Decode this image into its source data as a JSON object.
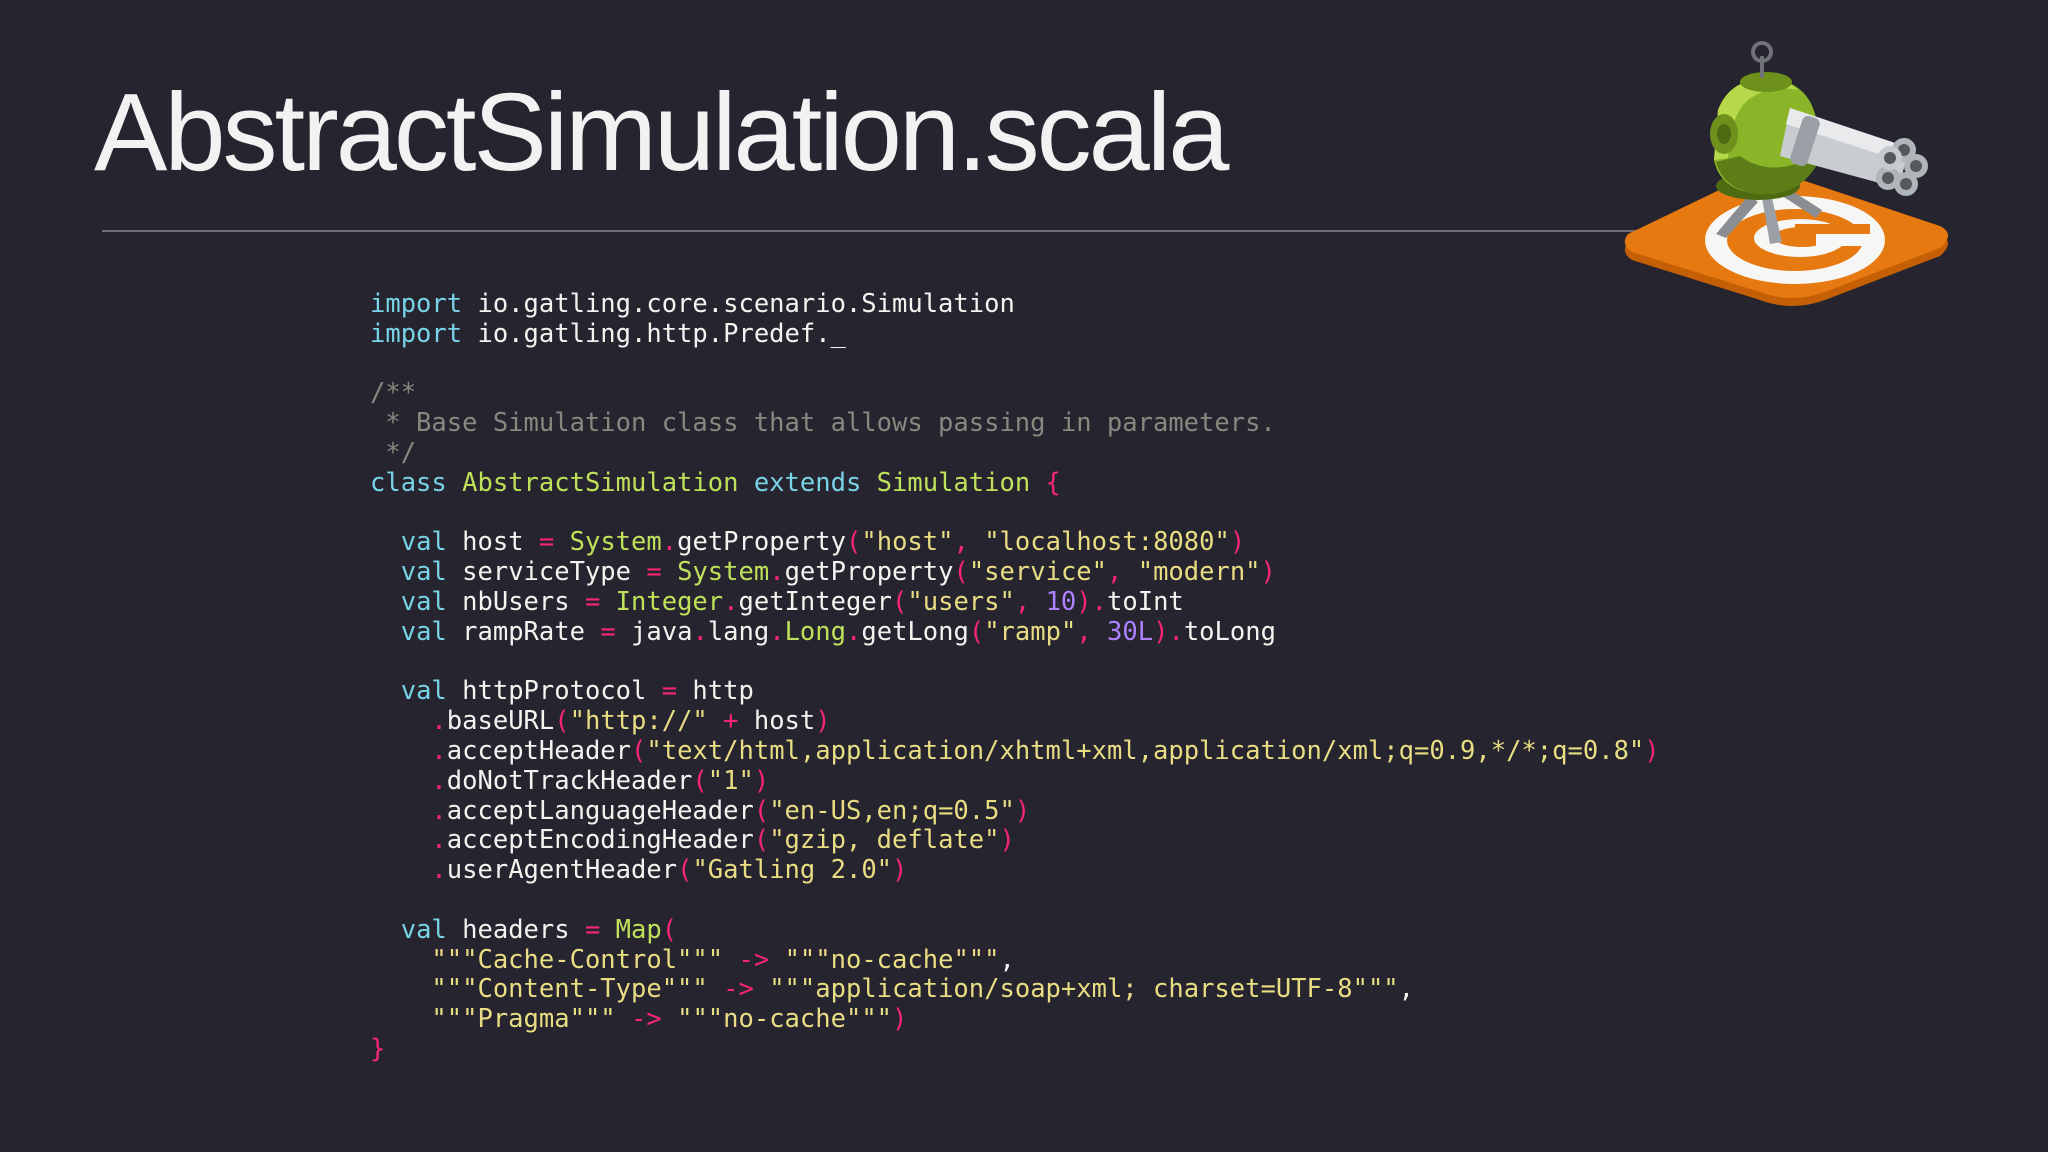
{
  "slide": {
    "title": "AbstractSimulation.scala"
  },
  "logo": {
    "icon": "gatling-cannon-logo"
  },
  "colors": {
    "background": "#25242f",
    "keyword": "#78d3e6",
    "type": "#bfe15a",
    "string": "#e9dd83",
    "number": "#ae81ff",
    "punctuation": "#f92672",
    "comment": "#88887f",
    "text": "#f3f3ef"
  },
  "code": {
    "language": "scala",
    "lines": [
      [
        [
          "kw",
          "import"
        ],
        [
          "tx",
          " io.gatling.core.scenario.Simulation"
        ]
      ],
      [
        [
          "kw",
          "import"
        ],
        [
          "tx",
          " io.gatling.http.Predef._"
        ]
      ],
      [],
      [
        [
          "cm",
          "/**"
        ]
      ],
      [
        [
          "cm",
          " * Base Simulation class that allows passing in parameters."
        ]
      ],
      [
        [
          "cm",
          " */"
        ]
      ],
      [
        [
          "kw",
          "class "
        ],
        [
          "ty",
          "AbstractSimulation "
        ],
        [
          "kw",
          "extends "
        ],
        [
          "ty",
          "Simulation "
        ],
        [
          "pu",
          "{"
        ]
      ],
      [],
      [
        [
          "tx",
          "  "
        ],
        [
          "kw",
          "val"
        ],
        [
          "tx",
          " host "
        ],
        [
          "pu",
          "="
        ],
        [
          "tx",
          " "
        ],
        [
          "ty",
          "System"
        ],
        [
          "pu",
          "."
        ],
        [
          "tx",
          "getProperty"
        ],
        [
          "pu",
          "("
        ],
        [
          "st",
          "\"host\""
        ],
        [
          "pu",
          ","
        ],
        [
          "tx",
          " "
        ],
        [
          "st",
          "\"localhost:8080\""
        ],
        [
          "pu",
          ")"
        ]
      ],
      [
        [
          "tx",
          "  "
        ],
        [
          "kw",
          "val"
        ],
        [
          "tx",
          " serviceType "
        ],
        [
          "pu",
          "="
        ],
        [
          "tx",
          " "
        ],
        [
          "ty",
          "System"
        ],
        [
          "pu",
          "."
        ],
        [
          "tx",
          "getProperty"
        ],
        [
          "pu",
          "("
        ],
        [
          "st",
          "\"service\""
        ],
        [
          "pu",
          ","
        ],
        [
          "tx",
          " "
        ],
        [
          "st",
          "\"modern\""
        ],
        [
          "pu",
          ")"
        ]
      ],
      [
        [
          "tx",
          "  "
        ],
        [
          "kw",
          "val"
        ],
        [
          "tx",
          " nbUsers "
        ],
        [
          "pu",
          "="
        ],
        [
          "tx",
          " "
        ],
        [
          "ty",
          "Integer"
        ],
        [
          "pu",
          "."
        ],
        [
          "tx",
          "getInteger"
        ],
        [
          "pu",
          "("
        ],
        [
          "st",
          "\"users\""
        ],
        [
          "pu",
          ","
        ],
        [
          "tx",
          " "
        ],
        [
          "nm",
          "10"
        ],
        [
          "pu",
          ")."
        ],
        [
          "tx",
          "toInt"
        ]
      ],
      [
        [
          "tx",
          "  "
        ],
        [
          "kw",
          "val"
        ],
        [
          "tx",
          " rampRate "
        ],
        [
          "pu",
          "="
        ],
        [
          "tx",
          " java"
        ],
        [
          "pu",
          "."
        ],
        [
          "tx",
          "lang"
        ],
        [
          "pu",
          "."
        ],
        [
          "ty",
          "Long"
        ],
        [
          "pu",
          "."
        ],
        [
          "tx",
          "getLong"
        ],
        [
          "pu",
          "("
        ],
        [
          "st",
          "\"ramp\""
        ],
        [
          "pu",
          ","
        ],
        [
          "tx",
          " "
        ],
        [
          "nm",
          "30L"
        ],
        [
          "pu",
          ")."
        ],
        [
          "tx",
          "toLong"
        ]
      ],
      [],
      [
        [
          "tx",
          "  "
        ],
        [
          "kw",
          "val"
        ],
        [
          "tx",
          " httpProtocol "
        ],
        [
          "pu",
          "="
        ],
        [
          "tx",
          " http"
        ]
      ],
      [
        [
          "tx",
          "    "
        ],
        [
          "pu",
          "."
        ],
        [
          "tx",
          "baseURL"
        ],
        [
          "pu",
          "("
        ],
        [
          "st",
          "\"http://\""
        ],
        [
          "tx",
          " "
        ],
        [
          "pu",
          "+"
        ],
        [
          "tx",
          " host"
        ],
        [
          "pu",
          ")"
        ]
      ],
      [
        [
          "tx",
          "    "
        ],
        [
          "pu",
          "."
        ],
        [
          "tx",
          "acceptHeader"
        ],
        [
          "pu",
          "("
        ],
        [
          "st",
          "\"text/html,application/xhtml+xml,application/xml;q=0.9,*/*;q=0.8\""
        ],
        [
          "pu",
          ")"
        ]
      ],
      [
        [
          "tx",
          "    "
        ],
        [
          "pu",
          "."
        ],
        [
          "tx",
          "doNotTrackHeader"
        ],
        [
          "pu",
          "("
        ],
        [
          "st",
          "\"1\""
        ],
        [
          "pu",
          ")"
        ]
      ],
      [
        [
          "tx",
          "    "
        ],
        [
          "pu",
          "."
        ],
        [
          "tx",
          "acceptLanguageHeader"
        ],
        [
          "pu",
          "("
        ],
        [
          "st",
          "\"en-US,en;q=0.5\""
        ],
        [
          "pu",
          ")"
        ]
      ],
      [
        [
          "tx",
          "    "
        ],
        [
          "pu",
          "."
        ],
        [
          "tx",
          "acceptEncodingHeader"
        ],
        [
          "pu",
          "("
        ],
        [
          "st",
          "\"gzip, deflate\""
        ],
        [
          "pu",
          ")"
        ]
      ],
      [
        [
          "tx",
          "    "
        ],
        [
          "pu",
          "."
        ],
        [
          "tx",
          "userAgentHeader"
        ],
        [
          "pu",
          "("
        ],
        [
          "st",
          "\"Gatling 2.0\""
        ],
        [
          "pu",
          ")"
        ]
      ],
      [],
      [
        [
          "tx",
          "  "
        ],
        [
          "kw",
          "val"
        ],
        [
          "tx",
          " headers "
        ],
        [
          "pu",
          "="
        ],
        [
          "tx",
          " "
        ],
        [
          "ty",
          "Map"
        ],
        [
          "pu",
          "("
        ]
      ],
      [
        [
          "tx",
          "    "
        ],
        [
          "st",
          "\"\"\"Cache-Control\"\"\""
        ],
        [
          "tx",
          " "
        ],
        [
          "pu",
          "->"
        ],
        [
          "tx",
          " "
        ],
        [
          "st",
          "\"\"\"no-cache\"\"\""
        ],
        [
          "tx",
          ","
        ]
      ],
      [
        [
          "tx",
          "    "
        ],
        [
          "st",
          "\"\"\"Content-Type\"\"\""
        ],
        [
          "tx",
          " "
        ],
        [
          "pu",
          "->"
        ],
        [
          "tx",
          " "
        ],
        [
          "st",
          "\"\"\"application/soap+xml; charset=UTF-8\"\"\""
        ],
        [
          "tx",
          ","
        ]
      ],
      [
        [
          "tx",
          "    "
        ],
        [
          "st",
          "\"\"\"Pragma\"\"\""
        ],
        [
          "tx",
          " "
        ],
        [
          "pu",
          "->"
        ],
        [
          "tx",
          " "
        ],
        [
          "st",
          "\"\"\"no-cache\"\"\""
        ],
        [
          "pu",
          ")"
        ]
      ],
      [
        [
          "pu",
          "}"
        ]
      ]
    ]
  }
}
